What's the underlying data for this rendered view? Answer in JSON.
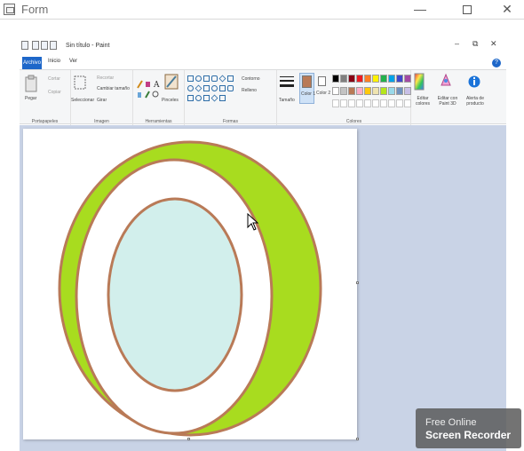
{
  "form": {
    "title": "Form",
    "minimize": "—",
    "close": "✕"
  },
  "paint": {
    "title": "Sin título - Paint",
    "window_min": "–",
    "window_max": "⧉",
    "window_close": "✕",
    "tabs": {
      "file": "Archivo",
      "home": "Inicio",
      "view": "Ver"
    },
    "help": "?",
    "ribbon": {
      "clipboard": {
        "paste": "Pegar",
        "cut": "Cortar",
        "copy": "Copiar",
        "label": "Portapapeles"
      },
      "image": {
        "select": "Seleccionar",
        "crop": "Recortar",
        "resize": "Cambiar tamaño",
        "rotate": "Girar",
        "label": "Imagen"
      },
      "tools": {
        "brushes": "Pinceles",
        "label": "Herramientas"
      },
      "shapes": {
        "outline": "Contorno",
        "fill": "Relleno",
        "label": "Formas"
      },
      "size": "Tamaño",
      "color1": "Color 1",
      "color2": "Color 2",
      "colors": {
        "label": "Colores",
        "edit": "Editar colores",
        "row1": [
          "#000000",
          "#7f7f7f",
          "#880015",
          "#ed1c24",
          "#ff7f27",
          "#fff200",
          "#22b14c",
          "#00a2e8",
          "#3f48cc",
          "#a349a4"
        ],
        "row2": [
          "#ffffff",
          "#c3c3c3",
          "#b97a57",
          "#ffaec9",
          "#ffc90e",
          "#efe4b0",
          "#b5e61d",
          "#99d9ea",
          "#7092be",
          "#c8bfe7"
        ]
      },
      "paint3d": "Editar con Paint 3D",
      "product_alert": "Alerta de producto"
    },
    "primary_color": "#b97a57",
    "drawing_colors": {
      "outline": "#b97a57",
      "ring": "#a8dc1f",
      "inner": "#d2efec"
    }
  },
  "watermark": {
    "line1": "Free Online",
    "line2": "Screen Recorder"
  }
}
